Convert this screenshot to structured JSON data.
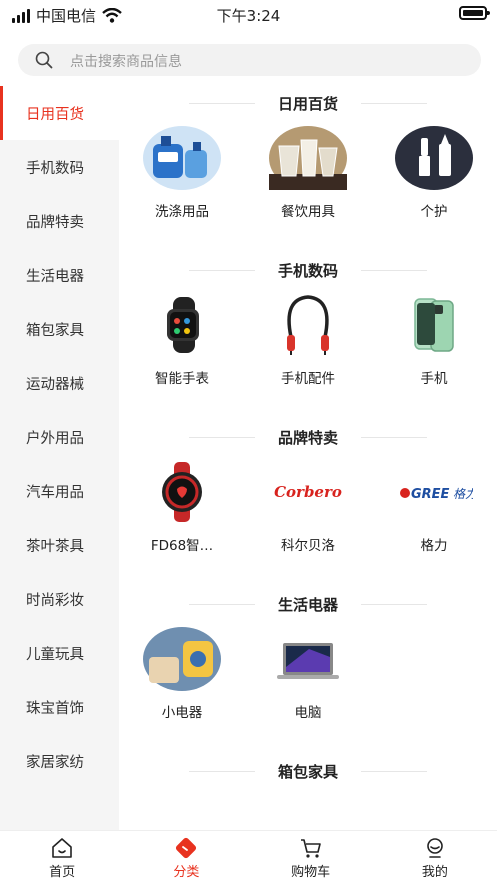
{
  "status": {
    "carrier": "中国电信",
    "time": "下午3:24"
  },
  "search": {
    "placeholder": "点击搜索商品信息"
  },
  "sidebar": {
    "items": [
      {
        "label": "日用百货"
      },
      {
        "label": "手机数码"
      },
      {
        "label": "品牌特卖"
      },
      {
        "label": "生活电器"
      },
      {
        "label": "箱包家具"
      },
      {
        "label": "运动器械"
      },
      {
        "label": "户外用品"
      },
      {
        "label": "汽车用品"
      },
      {
        "label": "茶叶茶具"
      },
      {
        "label": "时尚彩妆"
      },
      {
        "label": "儿童玩具"
      },
      {
        "label": "珠宝首饰"
      },
      {
        "label": "家居家纺"
      }
    ],
    "active_index": 0
  },
  "sections": [
    {
      "title": "日用百货",
      "items": [
        {
          "label": "洗涤用品",
          "icon": "detergent-image"
        },
        {
          "label": "餐饮用具",
          "icon": "glassware-image"
        },
        {
          "label": "个护",
          "icon": "lipstick-image"
        }
      ]
    },
    {
      "title": "手机数码",
      "items": [
        {
          "label": "智能手表",
          "icon": "smartwatch-image"
        },
        {
          "label": "手机配件",
          "icon": "earphones-image"
        },
        {
          "label": "手机",
          "icon": "phone-image"
        }
      ]
    },
    {
      "title": "品牌特卖",
      "items": [
        {
          "label": "FD68智…",
          "icon": "red-watch-image"
        },
        {
          "label": "科尔贝洛",
          "icon": "corbero-logo",
          "logo_text": "Corbero"
        },
        {
          "label": "格力",
          "icon": "gree-logo",
          "logo_text": "GREE格力"
        }
      ]
    },
    {
      "title": "生活电器",
      "items": [
        {
          "label": "小电器",
          "icon": "small-appliance-image"
        },
        {
          "label": "电脑",
          "icon": "laptop-image"
        }
      ]
    },
    {
      "title": "箱包家具",
      "items": []
    }
  ],
  "tabs": [
    {
      "label": "首页",
      "icon": "home-icon"
    },
    {
      "label": "分类",
      "icon": "category-icon"
    },
    {
      "label": "购物车",
      "icon": "cart-icon"
    },
    {
      "label": "我的",
      "icon": "profile-icon"
    }
  ],
  "colors": {
    "accent": "#e8321f",
    "sidebar_bg": "#f5f5f5"
  }
}
